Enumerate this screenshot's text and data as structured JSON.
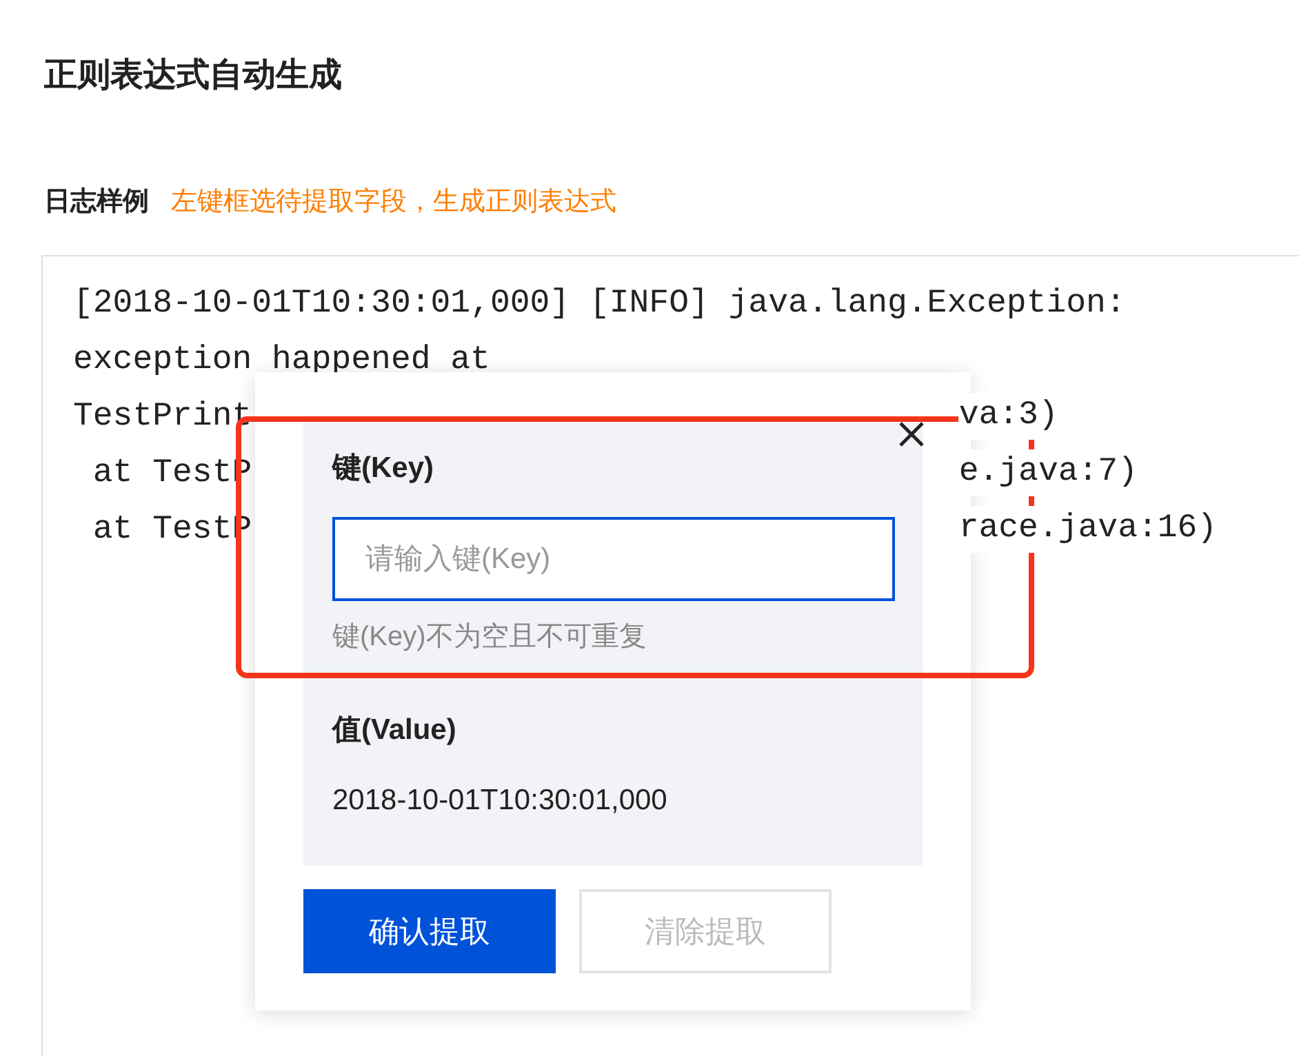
{
  "page": {
    "title": "正则表达式自动生成"
  },
  "sample": {
    "label": "日志样例",
    "hint": "左键框选待提取字段，生成正则表达式",
    "lines": [
      {
        "left": "[2018-10-01T10:30:01,000] [INFO] java.lang.Exception:"
      },
      {
        "left": "exception happened at"
      },
      {
        "left": "TestPrint",
        "right": "va:3)"
      },
      {
        "left": " at TestP",
        "right": "e.java:7)"
      },
      {
        "left": " at TestP",
        "right": "race.java:16)"
      }
    ]
  },
  "popover": {
    "key_label": "键(Key)",
    "key_field": {
      "placeholder": "请输入键(Key)"
    },
    "key_help": "键(Key)不为空且不可重复",
    "value_label": "值(Value)",
    "value": "2018-10-01T10:30:01,000",
    "buttons": [
      {
        "label": "确认提取",
        "kind": "primary",
        "disabled": false
      },
      {
        "label": "清除提取",
        "kind": "secondary",
        "disabled": true
      }
    ]
  }
}
